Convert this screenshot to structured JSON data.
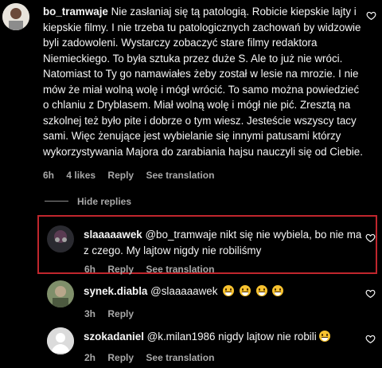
{
  "comments": [
    {
      "username": "bo_tramwaje",
      "text": "Nie zasłaniaj się tą patologią. Robicie kiepskie lajty i kiepskie filmy. I nie trzeba tu patologicznych zachowań by widzowie byli zadowoleni. Wystarczy zobaczyć stare filmy redaktora Niemieckiego. To była sztuka przez duże S. Ale to już nie wróci. Natomiast to Ty go namawiałes żeby został w lesie na mrozie. I nie mów że miał wolną wolę i mógł wrócić. To samo można powiedzieć o chlaniu z Dryblasem. Miał wolną wolę i mógł nie pić. Zresztą na szkolnej też było pite i dobrze o tym wiesz. Jesteście wszyscy tacy sami. Więc żenujące jest wybielanie się innymi patusami którzy wykorzystywania Majora do zarabiania hajsu nauczyli się od Ciebie.",
      "time": "6h",
      "likes": "4 likes",
      "reply": "Reply",
      "see_translation": "See translation"
    },
    {
      "username": "slaaaaawek",
      "text": "@bo_tramwaje nikt się nie wybiela, bo nie ma z czego. My lajtow nigdy nie robiliśmy",
      "time": "6h",
      "reply": "Reply",
      "see_translation": "See translation"
    },
    {
      "username": "synek.diabla",
      "text": "@slaaaaawek",
      "time": "3h",
      "reply": "Reply"
    },
    {
      "username": "szokadaniel",
      "text": "@k.milan1986 nigdy lajtow nie robili",
      "time": "2h",
      "reply": "Reply",
      "see_translation": "See translation"
    }
  ],
  "hide_replies": "Hide replies",
  "icons": {
    "heart": "heart-outline-icon",
    "emoji": "grinning-face-emoji"
  },
  "colors": {
    "background": "#000000",
    "highlight_border": "#c0262d",
    "meta": "#a8a8a8"
  }
}
